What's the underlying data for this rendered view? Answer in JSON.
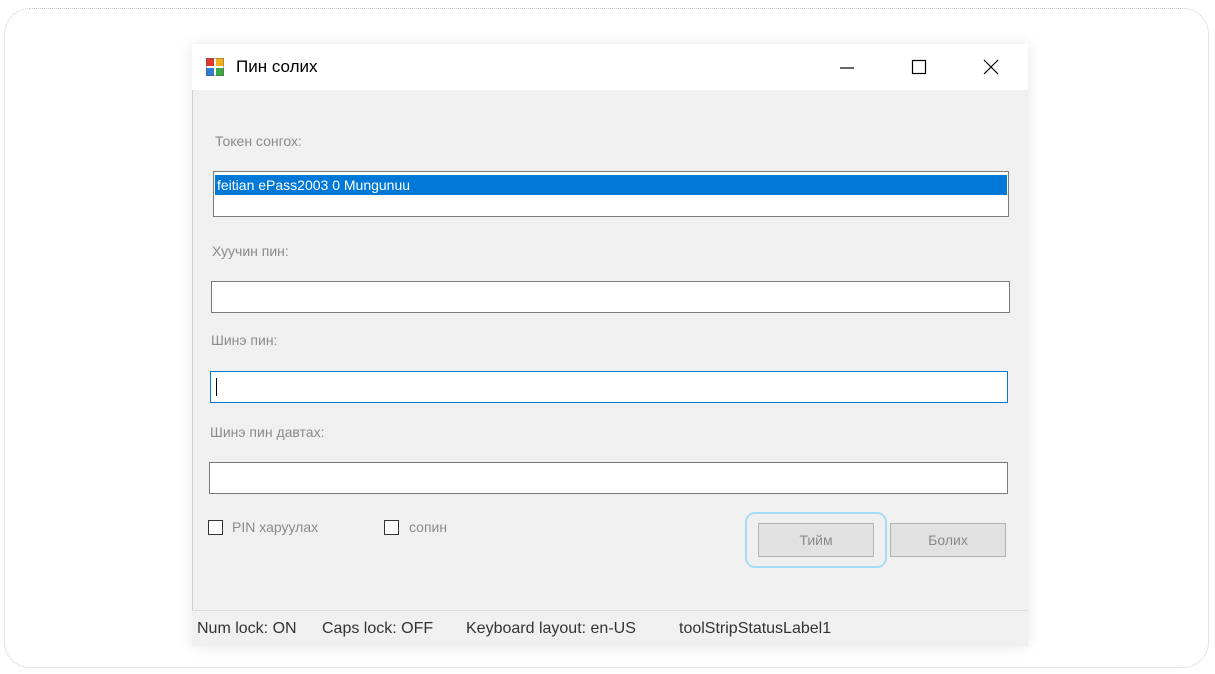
{
  "window": {
    "title": "Пин солих",
    "controls": {
      "minimize": "minimize-icon",
      "maximize": "maximize-icon",
      "close": "close-icon"
    }
  },
  "form": {
    "token_label": "Токен сонгох:",
    "token_list": [
      "feitian ePass2003 0 Mungunuu"
    ],
    "token_selected_index": 0,
    "old_pin_label": "Хуучин пин:",
    "old_pin_value": "",
    "new_pin_label": "Шинэ пин:",
    "new_pin_value": "",
    "repeat_pin_label": "Шинэ пин давтах:",
    "repeat_pin_value": "",
    "show_pin_checkbox_label": "PIN харуулах",
    "show_pin_checked": false,
    "other_checkbox_label": "сопин",
    "other_checked": false,
    "ok_label": "Тийм",
    "cancel_label": "Болих"
  },
  "status": {
    "num_lock": "Num lock: ON",
    "caps_lock": "Caps lock: OFF",
    "keyboard_layout": "Keyboard layout: en-US",
    "tool_label": "toolStripStatusLabel1"
  },
  "colors": {
    "selection": "#0078d7",
    "focus_ring": "#a6dcf2",
    "dialog_bg": "#f0f0f0"
  }
}
